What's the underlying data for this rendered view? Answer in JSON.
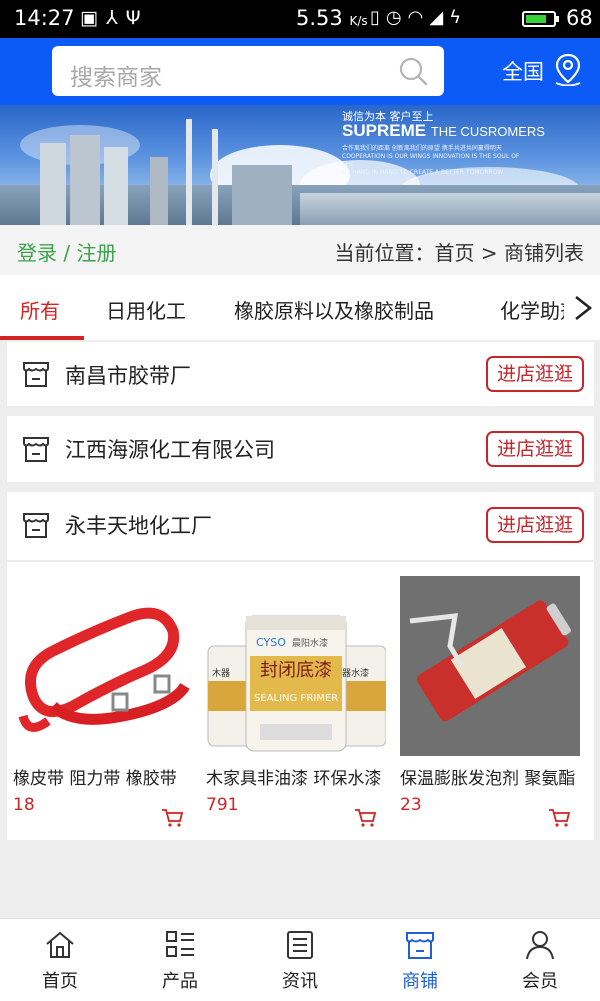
{
  "status_bar": {
    "time": "14:27",
    "network_speed": "5.53",
    "network_speed_unit": "K/s",
    "battery_level": "68",
    "icons": [
      "image-icon",
      "usb-debug-icon",
      "usb-icon",
      "vibrate-icon",
      "alarm-icon",
      "wifi-icon",
      "signal-4g-icon",
      "charging-icon",
      "battery-icon"
    ]
  },
  "header": {
    "search_placeholder": "搜索商家",
    "region_label": "全国",
    "accent_color": "#0d5bf6"
  },
  "banner": {
    "slogan_small": "诚信为本 客户至上",
    "slogan_main": "SUPREME",
    "slogan_main_suffix": "THE CUSROMERS",
    "slogan_line1": "合作离我们的距离 创新离我们的原望 携手共进共同赢得明天",
    "slogan_line2": "COOPERATION IS OUR WINGS INNOVATION IS THE SOUL OF THE",
    "slogan_line3": "US HAND IN HAND TO CREATE A BETTER TOMORROW"
  },
  "breadcrumb": {
    "login_label": "登录 / 注册",
    "location_label": "当前位置：首页 > 商铺列表"
  },
  "tabs": [
    {
      "label": "所有",
      "active": true
    },
    {
      "label": "日用化工",
      "active": false
    },
    {
      "label": "橡胶原料以及橡胶制品",
      "active": false
    },
    {
      "label": "化学助剂",
      "active": false
    }
  ],
  "shops": [
    {
      "name": "南昌市胶带厂",
      "button": "进店逛逛"
    },
    {
      "name": "江西海源化工有限公司",
      "button": "进店逛逛"
    },
    {
      "name": "永丰天地化工厂",
      "button": "进店逛逛"
    }
  ],
  "products": [
    {
      "name": "橡皮带 阻力带 橡胶带",
      "price": "18"
    },
    {
      "name": "木家具非油漆 环保水漆",
      "price": "791",
      "image_text": {
        "brand": "CYSO",
        "brand_cn": "晨阳水漆",
        "title": "封闭底漆",
        "subtitle": "SEALING PRIMER",
        "side_left": "木器",
        "side_right": "器水漆"
      }
    },
    {
      "name": "保温膨胀发泡剂 聚氨酯",
      "price": "23"
    }
  ],
  "bottom_nav": [
    {
      "label": "首页",
      "icon": "home-icon",
      "active": false
    },
    {
      "label": "产品",
      "icon": "grid-list-icon",
      "active": false
    },
    {
      "label": "资讯",
      "icon": "news-icon",
      "active": false
    },
    {
      "label": "商铺",
      "icon": "shop-icon",
      "active": true
    },
    {
      "label": "会员",
      "icon": "user-icon",
      "active": false
    }
  ],
  "colors": {
    "header_blue": "#0d5bf6",
    "tab_active_red": "#d32323",
    "button_red": "#c3262b",
    "login_green": "#3aa34a",
    "nav_active_blue": "#1f5fd8"
  }
}
